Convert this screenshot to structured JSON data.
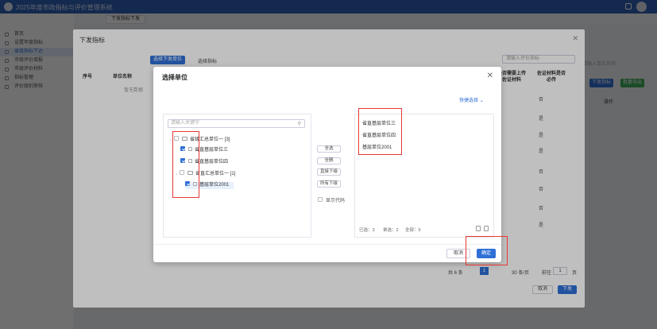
{
  "app": {
    "title": "2025年度市政指标与评价管理系统",
    "tab": "下发指标下发"
  },
  "sidebar": {
    "items": [
      {
        "label": "首页",
        "active": false
      },
      {
        "label": "设置年度指标",
        "active": false
      },
      {
        "label": "省级指标下达",
        "active": true
      },
      {
        "label": "市级评价填报",
        "active": false
      },
      {
        "label": "市级评价材料",
        "active": false
      },
      {
        "label": "指标管理",
        "active": false
      },
      {
        "label": "评价级别审核",
        "active": false
      }
    ]
  },
  "outer_dialog": {
    "title": "下发指标",
    "select_unit_button": "选择下发单位",
    "select_indicator": "选择指标",
    "search_placeholder": "请输入评价指标",
    "table_headers": [
      "序号",
      "单位名称",
      "是否需要上传佐证材料",
      "佐证材料是否必传"
    ],
    "empty_text": "暂无数据",
    "right_values": [
      "否",
      "是",
      "是",
      "是",
      "否",
      "否",
      "否",
      "是"
    ],
    "pagination": {
      "total": "共 6 条",
      "page": "1",
      "page_size": "30 条/页",
      "goto_label": "前往",
      "goto_value": "1",
      "page_suffix": "页"
    },
    "cancel": "取消",
    "confirm": "下发"
  },
  "background_right": {
    "search_hint": "请输入单位名称",
    "button_blue": "下发指标",
    "button_green": "批量导出",
    "column": "操作"
  },
  "dialog": {
    "title": "选择单位",
    "quick_select": "快捷选择",
    "search_placeholder": "请输入关键字",
    "tree": [
      {
        "label": "省级汇总单位一 [3]",
        "level": 0,
        "checked": false,
        "type": "folder"
      },
      {
        "label": "省直基层单位三",
        "level": 1,
        "checked": true,
        "type": "org"
      },
      {
        "label": "省直基层单位四",
        "level": 1,
        "checked": true,
        "type": "org"
      },
      {
        "label": "省直汇总单位一 [1]",
        "level": 1,
        "checked": false,
        "type": "folder"
      },
      {
        "label": "基层单位2001",
        "level": 2,
        "checked": true,
        "type": "org"
      }
    ],
    "mid_buttons": [
      "全选",
      "全删",
      "直接下级",
      "所有下级"
    ],
    "show_code": "显示代码",
    "selected": [
      "省直基层单位三",
      "省直基层单位四",
      "基层单位2001"
    ],
    "stats": {
      "selected": "已选：3",
      "unit": "单选：2",
      "total": "全部：5"
    },
    "cancel": "取消",
    "confirm": "确定"
  },
  "colors": {
    "primary": "#2f6fd6",
    "annotation": "#e53935",
    "topbar": "#2f5fb3"
  }
}
